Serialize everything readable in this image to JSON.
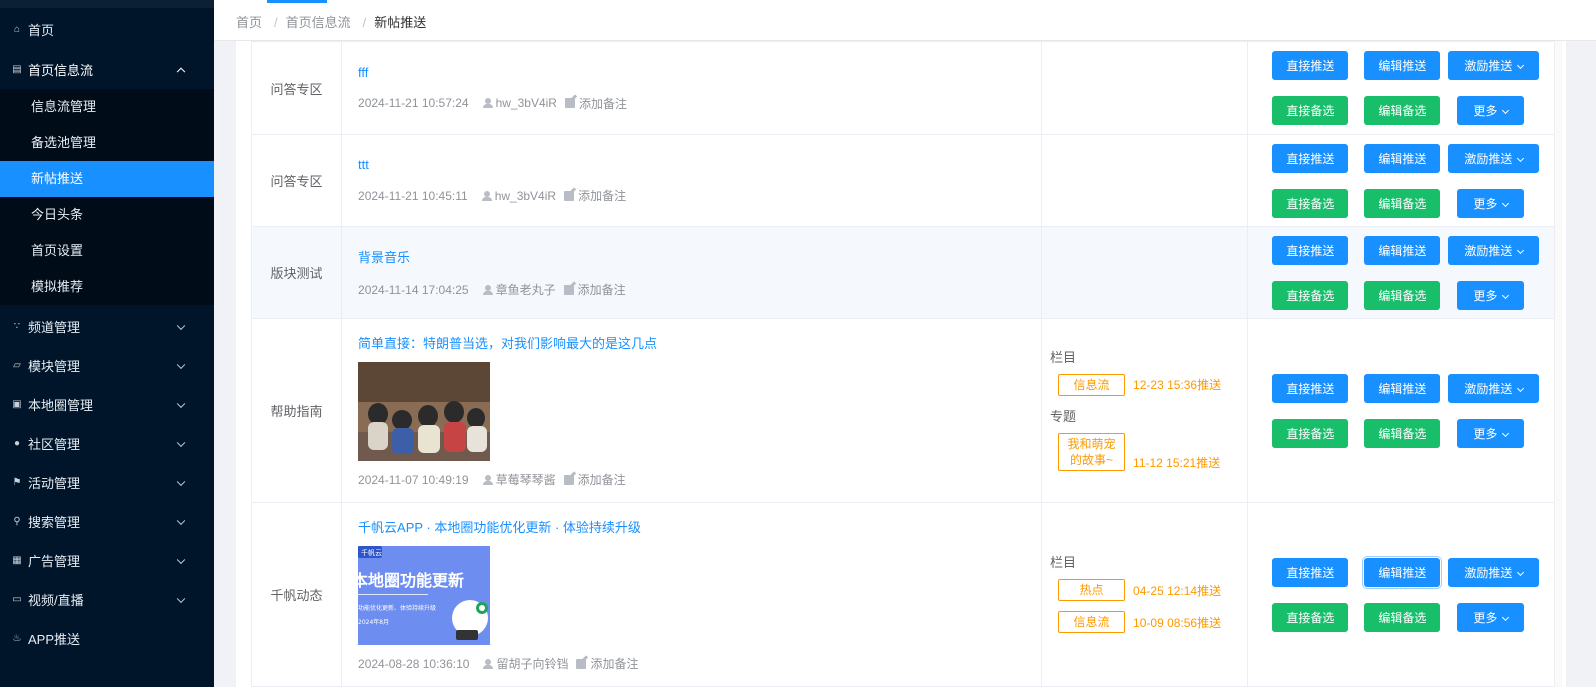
{
  "sidebar": {
    "items": [
      {
        "label": "首页",
        "icon": "home-icon"
      },
      {
        "label": "首页信息流",
        "icon": "document-icon",
        "sub": [
          "信息流管理",
          "备选池管理",
          "新帖推送",
          "今日头条",
          "首页设置",
          "模拟推荐"
        ]
      },
      {
        "label": "频道管理",
        "icon": "rss-icon"
      },
      {
        "label": "模块管理",
        "icon": "cube-icon"
      },
      {
        "label": "本地圈管理",
        "icon": "id-card-icon"
      },
      {
        "label": "社区管理",
        "icon": "user-circle-icon"
      },
      {
        "label": "活动管理",
        "icon": "flag-icon"
      },
      {
        "label": "搜索管理",
        "icon": "search-icon"
      },
      {
        "label": "广告管理",
        "icon": "image-icon"
      },
      {
        "label": "视频/直播",
        "icon": "monitor-icon"
      },
      {
        "label": "APP推送",
        "icon": "bell-icon"
      }
    ],
    "active_sub": "新帖推送"
  },
  "breadcrumb": [
    "首页",
    "首页信息流",
    "新帖推送"
  ],
  "breadcrumb_sep": "/",
  "buttons": {
    "direct_push": "直接推送",
    "edit_push": "编辑推送",
    "incentive_push": "激励推送",
    "direct_pick": "直接备选",
    "edit_pick": "编辑备选",
    "more": "更多"
  },
  "note_label": "添加备注",
  "column_label": "栏目",
  "topic_label": "专题",
  "rows": [
    {
      "category": "问答专区",
      "title": "fff",
      "time": "2024-11-21 10:57:24",
      "user": "hw_3bV4iR"
    },
    {
      "category": "问答专区",
      "title": "ttt",
      "time": "2024-11-21 10:45:11",
      "user": "hw_3bV4iR"
    },
    {
      "category": "版块测试",
      "title": "背景音乐",
      "time": "2024-11-14 17:04:25",
      "user": "章鱼老丸子"
    },
    {
      "category": "帮助指南",
      "title": "简单直接：特朗普当选，对我们影响最大的是这几点",
      "time": "2024-11-07 10:49:19",
      "user": "草莓琴琴酱",
      "col_tag": "信息流",
      "col_time": "12-23 15:36推送",
      "topic_tag": "我和萌宠的故事~",
      "topic_time": "11-12 15:21推送"
    },
    {
      "category": "千帆动态",
      "title": "千帆云APP · 本地圈功能优化更新 · 体验持续升级",
      "time": "2024-08-28 10:36:10",
      "user": "留胡子向铃铛",
      "col_tag1": "热点",
      "col_time1": "04-25 12:14推送",
      "col_tag2": "信息流",
      "col_time2": "10-09 08:56推送",
      "thumb_text1": "千帆云",
      "thumb_text2": "本地圈功能更新",
      "thumb_text3": "功能优化更新、体验持续升级",
      "thumb_text4": "2024年8月"
    }
  ]
}
